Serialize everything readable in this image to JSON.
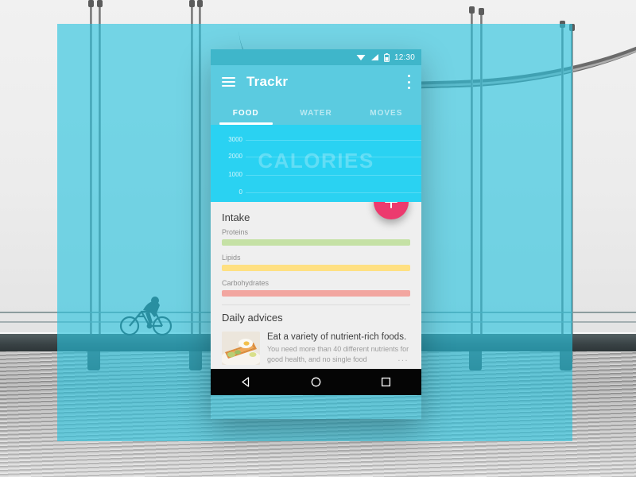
{
  "scene": {
    "background_description": "Grayscale photo of a cyclist riding across a suspension bridge over water",
    "overlay_color": "#26c4de"
  },
  "phone": {
    "statusbar": {
      "time": "12:30",
      "icons": [
        "wifi-icon",
        "signal-icon",
        "battery-icon"
      ]
    },
    "appbar": {
      "menu_icon": "hamburger-menu-icon",
      "title": "Trackr",
      "overflow_icon": "overflow-menu-icon"
    },
    "tabs": [
      {
        "label": "FOOD",
        "active": true
      },
      {
        "label": "WATER",
        "active": false
      },
      {
        "label": "MOVES",
        "active": false
      }
    ],
    "fab": {
      "icon": "plus-icon",
      "color": "#ec3a6e"
    },
    "intake": {
      "title": "Intake",
      "items": [
        {
          "label": "Proteins",
          "color": "#c5e1a5",
          "fill_pct": 100
        },
        {
          "label": "Lipids",
          "color": "#ffe082",
          "fill_pct": 100
        },
        {
          "label": "Carbohydrates",
          "color": "#f2a6a0",
          "fill_pct": 100
        }
      ]
    },
    "advices": {
      "title": "Daily advices",
      "items": [
        {
          "thumb": "food-photo-thumbnail",
          "headline": "Eat a variety of nutrient-rich foods.",
          "body": "You need more than 40 different nutrients for good health, and no single food",
          "more": "..."
        }
      ]
    },
    "navbar": {
      "buttons": [
        {
          "name": "back-button",
          "icon": "triangle-back-icon"
        },
        {
          "name": "home-button",
          "icon": "circle-home-icon"
        },
        {
          "name": "recents-button",
          "icon": "square-recents-icon"
        }
      ]
    }
  },
  "chart_data": {
    "type": "line",
    "title": "CALORIES",
    "xlabel": "",
    "ylabel": "",
    "categories": [],
    "values": [],
    "yticks": [
      3000,
      2000,
      1000,
      0
    ],
    "ylim": [
      0,
      3200
    ],
    "grid": true,
    "legend": "none",
    "background_color": "#2ad2f2"
  }
}
